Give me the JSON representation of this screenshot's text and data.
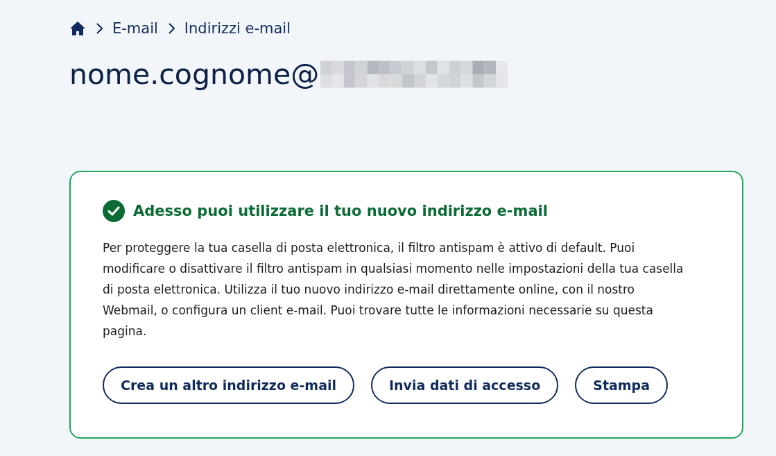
{
  "breadcrumb": [
    {
      "label": "E-mail"
    },
    {
      "label": "Indirizzi e-mail"
    }
  ],
  "title": "nome.cognome@",
  "notice": {
    "heading": "Adesso puoi utilizzare il tuo nuovo indirizzo e-mail",
    "body": "Per proteggere la tua casella di posta elettronica, il filtro antispam è attivo di default. Puoi modificare o disattivare il filtro antispam in qualsiasi momento nelle impostazioni della tua casella di posta elettronica. Utilizza il tuo nuovo indirizzo e-mail direttamente online, con il nostro Webmail, o configura un client e-mail. Puoi trovare tutte le informazioni necessarie su questa pagina.",
    "buttons": [
      {
        "label": "Crea un altro indirizzo e-mail"
      },
      {
        "label": "Invia dati di accesso"
      },
      {
        "label": "Stampa"
      }
    ]
  }
}
